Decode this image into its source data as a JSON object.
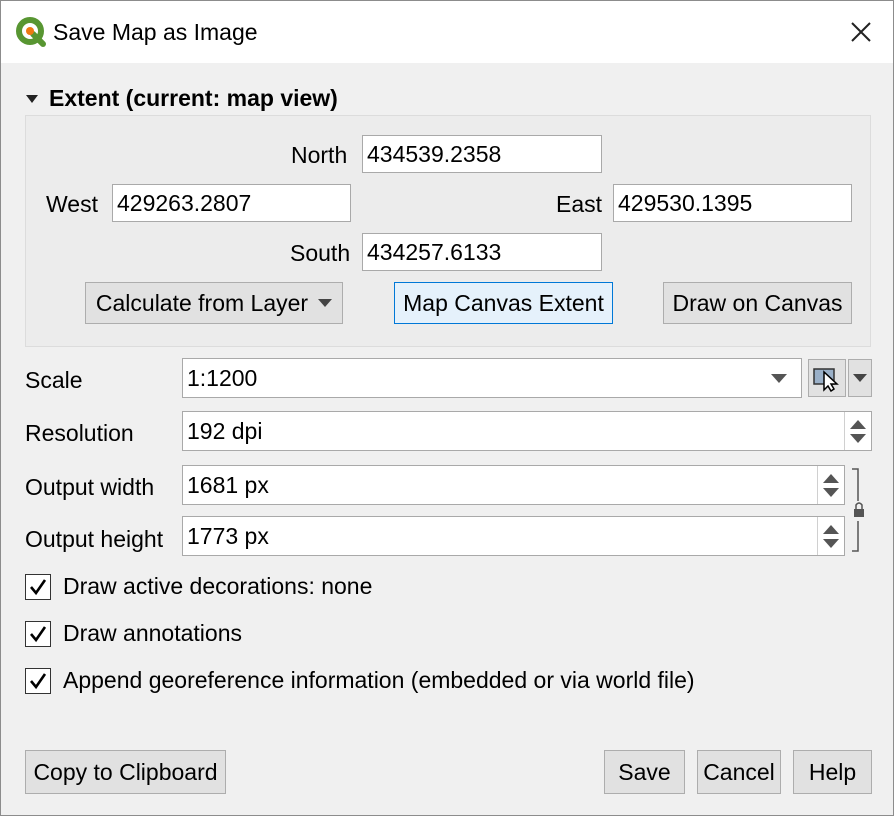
{
  "window": {
    "title": "Save Map as Image"
  },
  "extent": {
    "header": "Extent (current: map view)",
    "north_label": "North",
    "north_value": "434539.2358",
    "west_label": "West",
    "west_value": "429263.2807",
    "east_label": "East",
    "east_value": "429530.1395",
    "south_label": "South",
    "south_value": "434257.6133",
    "calc_layer_label": "Calculate from Layer",
    "map_canvas_label": "Map Canvas Extent",
    "draw_canvas_label": "Draw on Canvas"
  },
  "settings": {
    "scale_label": "Scale",
    "scale_value": "1:1200",
    "resolution_label": "Resolution",
    "resolution_value": "192 dpi",
    "width_label": "Output width",
    "width_value": "1681 px",
    "height_label": "Output height",
    "height_value": "1773 px"
  },
  "options": {
    "draw_decorations": {
      "label": "Draw active decorations: none",
      "checked": true
    },
    "draw_annotations": {
      "label": "Draw annotations",
      "checked": true
    },
    "append_georef": {
      "label": "Append georeference information (embedded or via world file)",
      "checked": true
    }
  },
  "footer": {
    "copy_label": "Copy to Clipboard",
    "save_label": "Save",
    "cancel_label": "Cancel",
    "help_label": "Help"
  },
  "icons": {
    "app": "qgis-logo-icon",
    "close": "close-icon",
    "group": "collapse-triangle-icon",
    "scale_from_map": "map-canvas-pointer-icon",
    "lock": "lock-icon",
    "check": "checkmark-icon"
  },
  "colors": {
    "qgis_green": "#589632",
    "qgis_yellow": "#ee7913",
    "focus_blue": "#0078d7"
  }
}
